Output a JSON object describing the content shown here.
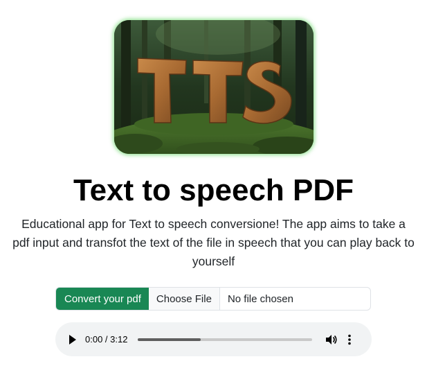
{
  "logo": {
    "text": "TTS",
    "icon": "tts-wooden-letters-forest-logo"
  },
  "header": {
    "title": "Text to speech PDF",
    "description": "Educational app for Text to speech conversione! The app aims to take a pdf input and transfot the text of the file in speech that you can play back to yourself"
  },
  "upload": {
    "label": "Convert your pdf",
    "choose_button": "Choose File",
    "status": "No file chosen"
  },
  "audio": {
    "time": "0:00 / 3:12",
    "progress_fraction": 0.36,
    "play_icon": "play-icon",
    "volume_icon": "volume-icon",
    "menu_icon": "more-vert-icon"
  },
  "colors": {
    "accent_green": "#198754",
    "logo_glow": "#78dc78",
    "audio_bg": "#f1f3f4"
  }
}
